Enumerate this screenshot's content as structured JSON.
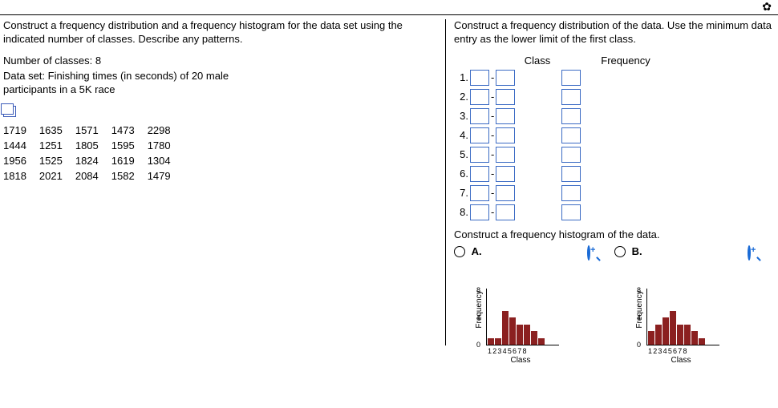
{
  "gear_icon": "✿",
  "left": {
    "prompt": "Construct a frequency distribution and a frequency histogram for the data set using the indicated number of classes. Describe any patterns.",
    "classes_line": "Number of classes: 8",
    "dataset_line": "Data set: Finishing times (in seconds) of 20 male participants in a 5K race",
    "data_rows": [
      [
        "1719",
        "1635",
        "1571",
        "1473",
        "2298"
      ],
      [
        "1444",
        "1251",
        "1805",
        "1595",
        "1780"
      ],
      [
        "1956",
        "1525",
        "1824",
        "1619",
        "1304"
      ],
      [
        "1818",
        "2021",
        "2084",
        "1582",
        "1479"
      ]
    ]
  },
  "right": {
    "prompt": "Construct a frequency distribution of the data. Use the minimum data entry as the lower limit of the first class.",
    "header_class": "Class",
    "header_freq": "Frequency",
    "row_count": 8,
    "hist_prompt": "Construct a frequency histogram of the data.",
    "choice_a": "A.",
    "choice_b": "B.",
    "chart": {
      "ylabel": "Frequency",
      "xlabel": "Class",
      "xticks": "12345678",
      "ytick0": "0",
      "ytick4": "4",
      "ytick8": "8"
    }
  },
  "chart_data": [
    {
      "type": "bar",
      "title": "A",
      "categories": [
        "1",
        "2",
        "3",
        "4",
        "5",
        "6",
        "7",
        "8"
      ],
      "values": [
        1,
        1,
        5,
        4,
        3,
        3,
        2,
        1
      ],
      "xlabel": "Class",
      "ylabel": "Frequency",
      "ylim": [
        0,
        8
      ]
    },
    {
      "type": "bar",
      "title": "B",
      "categories": [
        "1",
        "2",
        "3",
        "4",
        "5",
        "6",
        "7",
        "8"
      ],
      "values": [
        2,
        3,
        4,
        5,
        3,
        3,
        2,
        1
      ],
      "xlabel": "Class",
      "ylabel": "Frequency",
      "ylim": [
        0,
        8
      ]
    }
  ]
}
